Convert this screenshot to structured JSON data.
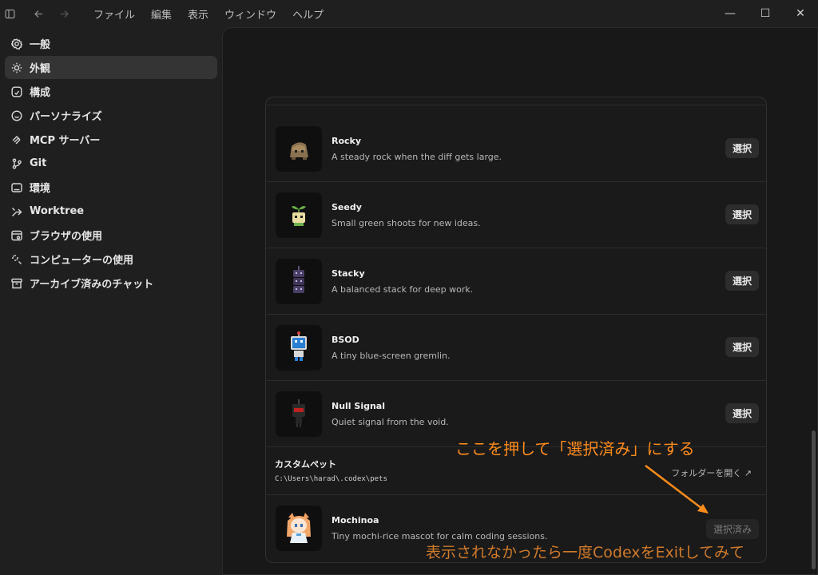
{
  "titlebar": {
    "menus": [
      "ファイル",
      "編集",
      "表示",
      "ウィンドウ",
      "ヘルプ"
    ],
    "controls": {
      "minimize": "—",
      "maximize": "☐",
      "close": "✕"
    }
  },
  "sidebar": {
    "items": [
      {
        "label": "一般",
        "icon": "gear-icon"
      },
      {
        "label": "外観",
        "icon": "sun-icon",
        "active": true
      },
      {
        "label": "構成",
        "icon": "config-icon"
      },
      {
        "label": "パーソナライズ",
        "icon": "personalize-icon"
      },
      {
        "label": "MCP サーバー",
        "icon": "mcp-icon"
      },
      {
        "label": "Git",
        "icon": "git-icon"
      },
      {
        "label": "環境",
        "icon": "terminal-icon"
      },
      {
        "label": "Worktree",
        "icon": "worktree-icon"
      },
      {
        "label": "ブラウザの使用",
        "icon": "browser-icon"
      },
      {
        "label": "コンピューターの使用",
        "icon": "sparkle-icon"
      },
      {
        "label": "アーカイブ済みのチャット",
        "icon": "archive-icon"
      }
    ]
  },
  "pets": [
    {
      "name": "Rocky",
      "desc": "A steady rock when the diff gets large.",
      "button": "選択"
    },
    {
      "name": "Seedy",
      "desc": "Small green shoots for new ideas.",
      "button": "選択"
    },
    {
      "name": "Stacky",
      "desc": "A balanced stack for deep work.",
      "button": "選択"
    },
    {
      "name": "BSOD",
      "desc": "A tiny blue-screen gremlin.",
      "button": "選択"
    },
    {
      "name": "Null Signal",
      "desc": "Quiet signal from the void.",
      "button": "選択"
    }
  ],
  "custom": {
    "title": "カスタムペット",
    "path": "C:\\Users\\harad\\.codex\\pets",
    "open_folder": "フォルダーを開く ↗"
  },
  "custom_pet": {
    "name": "Mochinoa",
    "desc": "Tiny mochi-rice mascot for calm coding sessions.",
    "button": "選択済み"
  },
  "annotations": {
    "top": "ここを押して「選択済み」にする",
    "bottom": "表示されなかったら一度CodexをExitしてみて",
    "color": "#ff8c1a"
  }
}
